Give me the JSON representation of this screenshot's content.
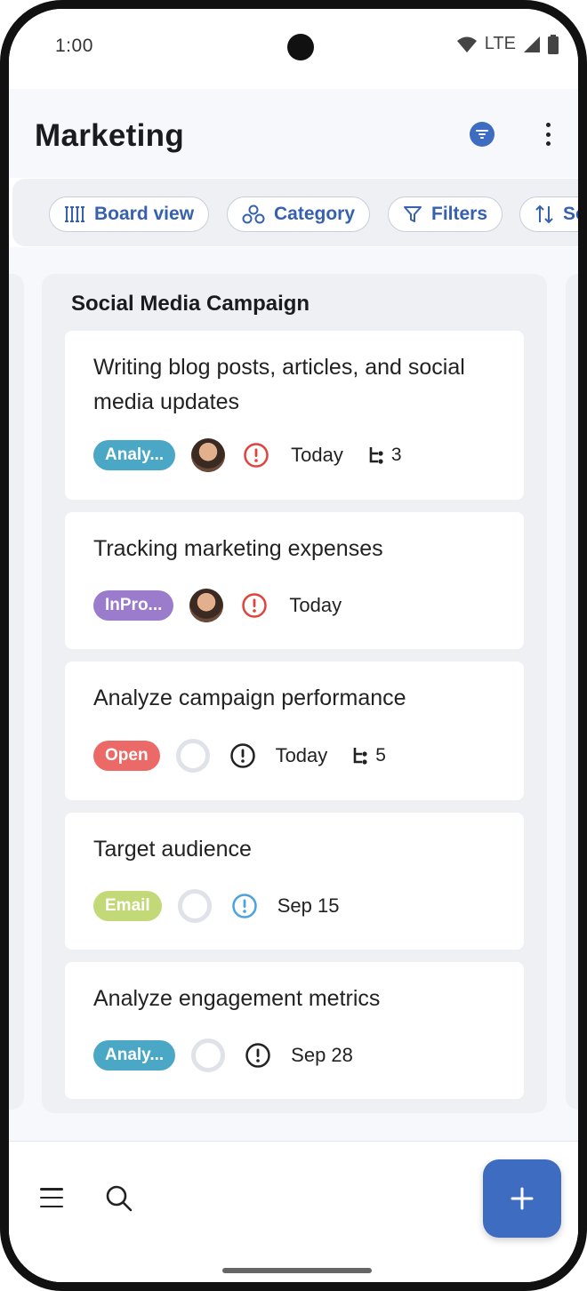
{
  "status": {
    "time": "1:00",
    "network": "LTE"
  },
  "header": {
    "title": "Marketing"
  },
  "chips": [
    {
      "label": "Board view"
    },
    {
      "label": "Category"
    },
    {
      "label": "Filters"
    },
    {
      "label": "So"
    }
  ],
  "column": {
    "title": "Social Media Campaign",
    "cards": [
      {
        "title": "Writing blog posts, articles, and social media updates",
        "status": "Analy...",
        "status_color": "#4aa7c6",
        "assignee": "photo",
        "priority_color": "#e0433b",
        "due": "Today",
        "subtasks": "3"
      },
      {
        "title": "Tracking marketing expenses",
        "status": "InPro...",
        "status_color": "#9a7bcc",
        "assignee": "photo",
        "priority_color": "#e0433b",
        "due": "Today",
        "subtasks": ""
      },
      {
        "title": "Analyze campaign performance",
        "status": "Open",
        "status_color": "#eb6a67",
        "assignee": "unassigned",
        "priority_color": "#222222",
        "due": "Today",
        "subtasks": "5"
      },
      {
        "title": "Target audience",
        "status": "Email",
        "status_color": "#c3d978",
        "assignee": "unassigned",
        "priority_color": "#4aa3e0",
        "due": "Sep 15",
        "subtasks": ""
      },
      {
        "title": "Analyze engagement metrics",
        "status": "Analy...",
        "status_color": "#4aa7c6",
        "assignee": "unassigned",
        "priority_color": "#222222",
        "due": "Sep 28",
        "subtasks": ""
      }
    ]
  },
  "icons": {
    "filter": "filter-funnel-icon",
    "more": "more-vertical-icon",
    "menu": "hamburger-menu-icon",
    "search": "search-icon",
    "add": "plus-icon"
  },
  "colors": {
    "accent": "#3d6cc0",
    "chip_text": "#3660b0"
  }
}
